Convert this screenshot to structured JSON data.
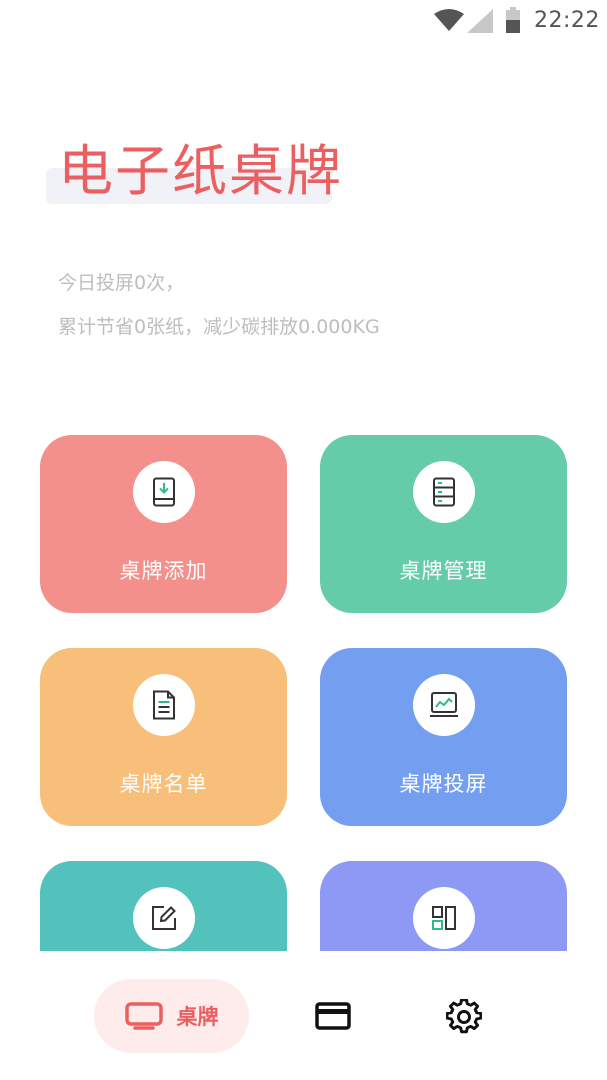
{
  "status_bar": {
    "time": "22:22",
    "icons": [
      "wifi-icon",
      "cell-signal-icon",
      "battery-icon"
    ]
  },
  "header": {
    "title": "电子纸桌牌",
    "stats_today": "今日投屏0次，",
    "stats_total": "累计节省0张纸，减少碳排放0.000KG"
  },
  "tiles": [
    {
      "label": "桌牌添加",
      "icon": "tablet-download-icon",
      "color": "#f3908b"
    },
    {
      "label": "桌牌管理",
      "icon": "server-icon",
      "color": "#65ccaa"
    },
    {
      "label": "桌牌名单",
      "icon": "document-icon",
      "color": "#f7bf79"
    },
    {
      "label": "桌牌投屏",
      "icon": "monitor-chart-icon",
      "color": "#749ff0"
    },
    {
      "label": "",
      "icon": "edit-icon",
      "color": "#53c2bc"
    },
    {
      "label": "",
      "icon": "layout-icon",
      "color": "#8e98f5"
    }
  ],
  "bottom_nav": {
    "items": [
      {
        "label": "桌牌",
        "icon": "tv-icon",
        "active": true
      },
      {
        "label": "",
        "icon": "card-icon",
        "active": false
      },
      {
        "label": "",
        "icon": "gear-icon",
        "active": false
      }
    ],
    "accent": "#ec5f60"
  }
}
